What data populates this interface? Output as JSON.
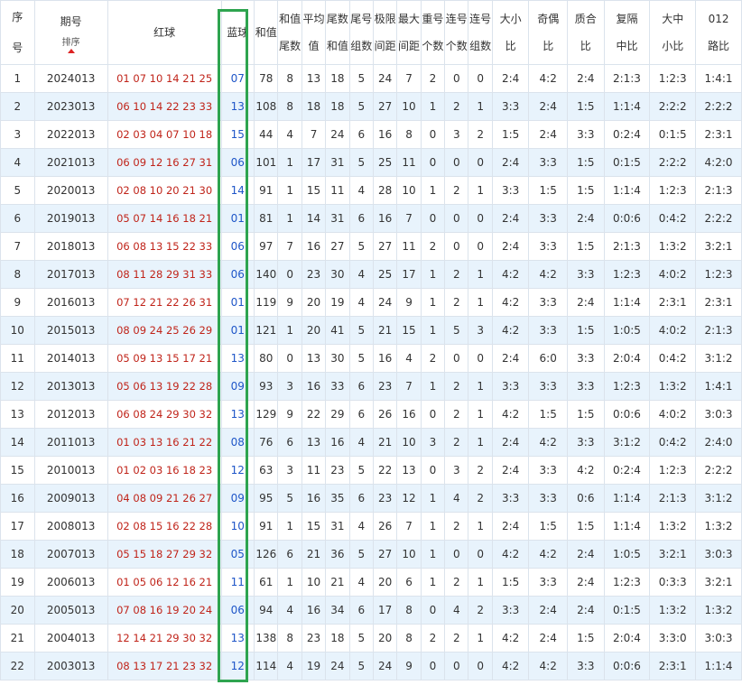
{
  "columns": {
    "seq": [
      "序",
      "号"
    ],
    "issue": "期号",
    "sort_label": "排序",
    "red": "红球",
    "blue": "蓝球",
    "sum": "和值",
    "sum_tail": [
      "和值",
      "尾数"
    ],
    "avg": [
      "平均",
      "值"
    ],
    "tail_sum": [
      "尾数",
      "和值"
    ],
    "tail_groups": [
      "尾号",
      "组数"
    ],
    "range": [
      "极限",
      "间距"
    ],
    "max_gap": [
      "最大",
      "间距"
    ],
    "repeat": [
      "重号",
      "个数"
    ],
    "consec_count": [
      "连号",
      "个数"
    ],
    "consec_groups": [
      "连号",
      "组数"
    ],
    "big_small": [
      "大小",
      "比"
    ],
    "odd_even": [
      "奇偶",
      "比"
    ],
    "prime_comp": [
      "质合",
      "比"
    ],
    "repeat_gap": [
      "复隔",
      "中比"
    ],
    "size3": [
      "大中",
      "小比"
    ],
    "road012": [
      "012",
      "路比"
    ]
  },
  "rows": [
    {
      "seq": "1",
      "issue": "2024013",
      "red": "01 07 10 14 21 25",
      "blue": "07",
      "sum": "78",
      "sum_tail": "8",
      "avg": "13",
      "tail_sum": "18",
      "tail_groups": "5",
      "range": "24",
      "max_gap": "7",
      "repeat": "2",
      "consec_count": "0",
      "consec_groups": "0",
      "big_small": "2:4",
      "odd_even": "4:2",
      "prime_comp": "2:4",
      "repeat_gap": "2:1:3",
      "size3": "1:2:3",
      "road012": "1:4:1"
    },
    {
      "seq": "2",
      "issue": "2023013",
      "red": "06 10 14 22 23 33",
      "blue": "13",
      "sum": "108",
      "sum_tail": "8",
      "avg": "18",
      "tail_sum": "18",
      "tail_groups": "5",
      "range": "27",
      "max_gap": "10",
      "repeat": "1",
      "consec_count": "2",
      "consec_groups": "1",
      "big_small": "3:3",
      "odd_even": "2:4",
      "prime_comp": "1:5",
      "repeat_gap": "1:1:4",
      "size3": "2:2:2",
      "road012": "2:2:2"
    },
    {
      "seq": "3",
      "issue": "2022013",
      "red": "02 03 04 07 10 18",
      "blue": "15",
      "sum": "44",
      "sum_tail": "4",
      "avg": "7",
      "tail_sum": "24",
      "tail_groups": "6",
      "range": "16",
      "max_gap": "8",
      "repeat": "0",
      "consec_count": "3",
      "consec_groups": "2",
      "big_small": "1:5",
      "odd_even": "2:4",
      "prime_comp": "3:3",
      "repeat_gap": "0:2:4",
      "size3": "0:1:5",
      "road012": "2:3:1"
    },
    {
      "seq": "4",
      "issue": "2021013",
      "red": "06 09 12 16 27 31",
      "blue": "06",
      "sum": "101",
      "sum_tail": "1",
      "avg": "17",
      "tail_sum": "31",
      "tail_groups": "5",
      "range": "25",
      "max_gap": "11",
      "repeat": "0",
      "consec_count": "0",
      "consec_groups": "0",
      "big_small": "2:4",
      "odd_even": "3:3",
      "prime_comp": "1:5",
      "repeat_gap": "0:1:5",
      "size3": "2:2:2",
      "road012": "4:2:0"
    },
    {
      "seq": "5",
      "issue": "2020013",
      "red": "02 08 10 20 21 30",
      "blue": "14",
      "sum": "91",
      "sum_tail": "1",
      "avg": "15",
      "tail_sum": "11",
      "tail_groups": "4",
      "range": "28",
      "max_gap": "10",
      "repeat": "1",
      "consec_count": "2",
      "consec_groups": "1",
      "big_small": "3:3",
      "odd_even": "1:5",
      "prime_comp": "1:5",
      "repeat_gap": "1:1:4",
      "size3": "1:2:3",
      "road012": "2:1:3"
    },
    {
      "seq": "6",
      "issue": "2019013",
      "red": "05 07 14 16 18 21",
      "blue": "01",
      "sum": "81",
      "sum_tail": "1",
      "avg": "14",
      "tail_sum": "31",
      "tail_groups": "6",
      "range": "16",
      "max_gap": "7",
      "repeat": "0",
      "consec_count": "0",
      "consec_groups": "0",
      "big_small": "2:4",
      "odd_even": "3:3",
      "prime_comp": "2:4",
      "repeat_gap": "0:0:6",
      "size3": "0:4:2",
      "road012": "2:2:2"
    },
    {
      "seq": "7",
      "issue": "2018013",
      "red": "06 08 13 15 22 33",
      "blue": "06",
      "sum": "97",
      "sum_tail": "7",
      "avg": "16",
      "tail_sum": "27",
      "tail_groups": "5",
      "range": "27",
      "max_gap": "11",
      "repeat": "2",
      "consec_count": "0",
      "consec_groups": "0",
      "big_small": "2:4",
      "odd_even": "3:3",
      "prime_comp": "1:5",
      "repeat_gap": "2:1:3",
      "size3": "1:3:2",
      "road012": "3:2:1"
    },
    {
      "seq": "8",
      "issue": "2017013",
      "red": "08 11 28 29 31 33",
      "blue": "06",
      "sum": "140",
      "sum_tail": "0",
      "avg": "23",
      "tail_sum": "30",
      "tail_groups": "4",
      "range": "25",
      "max_gap": "17",
      "repeat": "1",
      "consec_count": "2",
      "consec_groups": "1",
      "big_small": "4:2",
      "odd_even": "4:2",
      "prime_comp": "3:3",
      "repeat_gap": "1:2:3",
      "size3": "4:0:2",
      "road012": "1:2:3"
    },
    {
      "seq": "9",
      "issue": "2016013",
      "red": "07 12 21 22 26 31",
      "blue": "01",
      "sum": "119",
      "sum_tail": "9",
      "avg": "20",
      "tail_sum": "19",
      "tail_groups": "4",
      "range": "24",
      "max_gap": "9",
      "repeat": "1",
      "consec_count": "2",
      "consec_groups": "1",
      "big_small": "4:2",
      "odd_even": "3:3",
      "prime_comp": "2:4",
      "repeat_gap": "1:1:4",
      "size3": "2:3:1",
      "road012": "2:3:1"
    },
    {
      "seq": "10",
      "issue": "2015013",
      "red": "08 09 24 25 26 29",
      "blue": "01",
      "sum": "121",
      "sum_tail": "1",
      "avg": "20",
      "tail_sum": "41",
      "tail_groups": "5",
      "range": "21",
      "max_gap": "15",
      "repeat": "1",
      "consec_count": "5",
      "consec_groups": "3",
      "big_small": "4:2",
      "odd_even": "3:3",
      "prime_comp": "1:5",
      "repeat_gap": "1:0:5",
      "size3": "4:0:2",
      "road012": "2:1:3"
    },
    {
      "seq": "11",
      "issue": "2014013",
      "red": "05 09 13 15 17 21",
      "blue": "13",
      "sum": "80",
      "sum_tail": "0",
      "avg": "13",
      "tail_sum": "30",
      "tail_groups": "5",
      "range": "16",
      "max_gap": "4",
      "repeat": "2",
      "consec_count": "0",
      "consec_groups": "0",
      "big_small": "2:4",
      "odd_even": "6:0",
      "prime_comp": "3:3",
      "repeat_gap": "2:0:4",
      "size3": "0:4:2",
      "road012": "3:1:2"
    },
    {
      "seq": "12",
      "issue": "2013013",
      "red": "05 06 13 19 22 28",
      "blue": "09",
      "sum": "93",
      "sum_tail": "3",
      "avg": "16",
      "tail_sum": "33",
      "tail_groups": "6",
      "range": "23",
      "max_gap": "7",
      "repeat": "1",
      "consec_count": "2",
      "consec_groups": "1",
      "big_small": "3:3",
      "odd_even": "3:3",
      "prime_comp": "3:3",
      "repeat_gap": "1:2:3",
      "size3": "1:3:2",
      "road012": "1:4:1"
    },
    {
      "seq": "13",
      "issue": "2012013",
      "red": "06 08 24 29 30 32",
      "blue": "13",
      "sum": "129",
      "sum_tail": "9",
      "avg": "22",
      "tail_sum": "29",
      "tail_groups": "6",
      "range": "26",
      "max_gap": "16",
      "repeat": "0",
      "consec_count": "2",
      "consec_groups": "1",
      "big_small": "4:2",
      "odd_even": "1:5",
      "prime_comp": "1:5",
      "repeat_gap": "0:0:6",
      "size3": "4:0:2",
      "road012": "3:0:3"
    },
    {
      "seq": "14",
      "issue": "2011013",
      "red": "01 03 13 16 21 22",
      "blue": "08",
      "sum": "76",
      "sum_tail": "6",
      "avg": "13",
      "tail_sum": "16",
      "tail_groups": "4",
      "range": "21",
      "max_gap": "10",
      "repeat": "3",
      "consec_count": "2",
      "consec_groups": "1",
      "big_small": "2:4",
      "odd_even": "4:2",
      "prime_comp": "3:3",
      "repeat_gap": "3:1:2",
      "size3": "0:4:2",
      "road012": "2:4:0"
    },
    {
      "seq": "15",
      "issue": "2010013",
      "red": "01 02 03 16 18 23",
      "blue": "12",
      "sum": "63",
      "sum_tail": "3",
      "avg": "11",
      "tail_sum": "23",
      "tail_groups": "5",
      "range": "22",
      "max_gap": "13",
      "repeat": "0",
      "consec_count": "3",
      "consec_groups": "2",
      "big_small": "2:4",
      "odd_even": "3:3",
      "prime_comp": "4:2",
      "repeat_gap": "0:2:4",
      "size3": "1:2:3",
      "road012": "2:2:2"
    },
    {
      "seq": "16",
      "issue": "2009013",
      "red": "04 08 09 21 26 27",
      "blue": "09",
      "sum": "95",
      "sum_tail": "5",
      "avg": "16",
      "tail_sum": "35",
      "tail_groups": "6",
      "range": "23",
      "max_gap": "12",
      "repeat": "1",
      "consec_count": "4",
      "consec_groups": "2",
      "big_small": "3:3",
      "odd_even": "3:3",
      "prime_comp": "0:6",
      "repeat_gap": "1:1:4",
      "size3": "2:1:3",
      "road012": "3:1:2"
    },
    {
      "seq": "17",
      "issue": "2008013",
      "red": "02 08 15 16 22 28",
      "blue": "10",
      "sum": "91",
      "sum_tail": "1",
      "avg": "15",
      "tail_sum": "31",
      "tail_groups": "4",
      "range": "26",
      "max_gap": "7",
      "repeat": "1",
      "consec_count": "2",
      "consec_groups": "1",
      "big_small": "2:4",
      "odd_even": "1:5",
      "prime_comp": "1:5",
      "repeat_gap": "1:1:4",
      "size3": "1:3:2",
      "road012": "1:3:2"
    },
    {
      "seq": "18",
      "issue": "2007013",
      "red": "05 15 18 27 29 32",
      "blue": "05",
      "sum": "126",
      "sum_tail": "6",
      "avg": "21",
      "tail_sum": "36",
      "tail_groups": "5",
      "range": "27",
      "max_gap": "10",
      "repeat": "1",
      "consec_count": "0",
      "consec_groups": "0",
      "big_small": "4:2",
      "odd_even": "4:2",
      "prime_comp": "2:4",
      "repeat_gap": "1:0:5",
      "size3": "3:2:1",
      "road012": "3:0:3"
    },
    {
      "seq": "19",
      "issue": "2006013",
      "red": "01 05 06 12 16 21",
      "blue": "11",
      "sum": "61",
      "sum_tail": "1",
      "avg": "10",
      "tail_sum": "21",
      "tail_groups": "4",
      "range": "20",
      "max_gap": "6",
      "repeat": "1",
      "consec_count": "2",
      "consec_groups": "1",
      "big_small": "1:5",
      "odd_even": "3:3",
      "prime_comp": "2:4",
      "repeat_gap": "1:2:3",
      "size3": "0:3:3",
      "road012": "3:2:1"
    },
    {
      "seq": "20",
      "issue": "2005013",
      "red": "07 08 16 19 20 24",
      "blue": "06",
      "sum": "94",
      "sum_tail": "4",
      "avg": "16",
      "tail_sum": "34",
      "tail_groups": "6",
      "range": "17",
      "max_gap": "8",
      "repeat": "0",
      "consec_count": "4",
      "consec_groups": "2",
      "big_small": "3:3",
      "odd_even": "2:4",
      "prime_comp": "2:4",
      "repeat_gap": "0:1:5",
      "size3": "1:3:2",
      "road012": "1:3:2"
    },
    {
      "seq": "21",
      "issue": "2004013",
      "red": "12 14 21 29 30 32",
      "blue": "13",
      "sum": "138",
      "sum_tail": "8",
      "avg": "23",
      "tail_sum": "18",
      "tail_groups": "5",
      "range": "20",
      "max_gap": "8",
      "repeat": "2",
      "consec_count": "2",
      "consec_groups": "1",
      "big_small": "4:2",
      "odd_even": "2:4",
      "prime_comp": "1:5",
      "repeat_gap": "2:0:4",
      "size3": "3:3:0",
      "road012": "3:0:3"
    },
    {
      "seq": "22",
      "issue": "2003013",
      "red": "08 13 17 21 23 32",
      "blue": "12",
      "sum": "114",
      "sum_tail": "4",
      "avg": "19",
      "tail_sum": "24",
      "tail_groups": "5",
      "range": "24",
      "max_gap": "9",
      "repeat": "0",
      "consec_count": "0",
      "consec_groups": "0",
      "big_small": "4:2",
      "odd_even": "4:2",
      "prime_comp": "3:3",
      "repeat_gap": "0:0:6",
      "size3": "2:3:1",
      "road012": "1:1:4"
    }
  ],
  "colors": {
    "red_ball": "#c0241a",
    "blue_ball": "#1f56c8",
    "highlight_border": "#2ea44f",
    "row_alt": "#e8f3fc",
    "sort_arrow": "#d22"
  }
}
